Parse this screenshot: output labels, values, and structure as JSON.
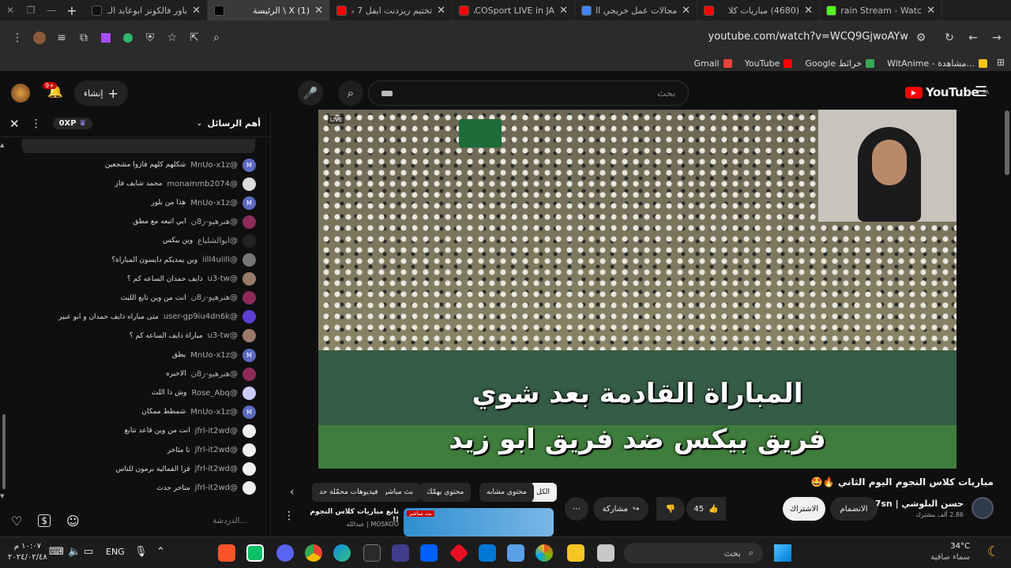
{
  "tabs": [
    {
      "title": "باور فالكونز ابوعابد الـ",
      "favicon": "tiktok-icon",
      "color": "#111111",
      "active": false
    },
    {
      "title": "(1) X \\ الرئيسة",
      "favicon": "x-icon",
      "color": "#000000",
      "active": true
    },
    {
      "title": "تختيم ريزدنت ايفل 7 ب",
      "favicon": "youtube-icon",
      "color": "#ff0000",
      "active": false
    },
    {
      "title": "JACOSport LIVE in JA",
      "favicon": "youtube-icon",
      "color": "#ff0000",
      "active": false
    },
    {
      "title": "مجالات عمل خريجي ال",
      "favicon": "gemini-icon",
      "color": "#4285f4",
      "active": false
    },
    {
      "title": "(4680) مباريات كلا",
      "favicon": "youtube-icon",
      "color": "#ff0000",
      "active": false
    },
    {
      "title": "Brain Stream - Watc",
      "favicon": "kick-icon",
      "color": "#53fc18",
      "active": false
    }
  ],
  "address": {
    "url": "youtube.com/watch?v=WCQ9GjwoAYw"
  },
  "bookmarks": [
    {
      "label": "Gmail",
      "color": "#ea4335"
    },
    {
      "label": "YouTube",
      "color": "#ff0000"
    },
    {
      "label": "Google خرائط",
      "color": "#34a853"
    },
    {
      "label": "WitAnime - مشاهدة...",
      "color": "#f5c518"
    }
  ],
  "youtube": {
    "logo": "YouTube",
    "region": "SA",
    "search_placeholder": "بحث",
    "create_label": "إنشاء",
    "notif_count": "9+"
  },
  "chat": {
    "title": "أهم الرسائل",
    "points": "0XP",
    "input_placeholder": "الدردشة...",
    "messages": [
      {
        "user": "@MnUo-x1z",
        "text": "شكلهم كلهم فازوا مشجعين",
        "avatar": "M",
        "color": "#5c6bc0"
      },
      {
        "user": "@monammb2074",
        "text": "محمد شايف فاز",
        "avatar": "",
        "color": "#dddddd"
      },
      {
        "user": "@MnUo-x1z",
        "text": "هذا من بلور",
        "avatar": "M",
        "color": "#5c6bc0"
      },
      {
        "user": "@هنرهيو-ز8ن",
        "text": "ابي اتبعه مع مطق",
        "avatar": "",
        "color": "#8e2a5a"
      },
      {
        "user": "@ابوالشلباع",
        "text": "وين بيكس",
        "avatar": "",
        "color": "#222222"
      },
      {
        "user": "@iill4uiill",
        "text": "وين يمديكم دايسون المباراة؟",
        "avatar": "",
        "color": "#777777"
      },
      {
        "user": "@u3-tw",
        "text": "ذايف حمدان الساعه كم ؟",
        "avatar": "",
        "color": "#9a7a6a"
      },
      {
        "user": "@هنرهيو-ز8ن",
        "text": "انت من وين تابع الليث",
        "avatar": "",
        "color": "#8e2a5a"
      },
      {
        "user": "@user-gp9iu4dn6k",
        "text": "متى مباراه ذايف حمدان و ابو عبير",
        "avatar": "",
        "color": "#5d3fd3"
      },
      {
        "user": "@u3-tw",
        "text": "مباراة ذايف الساعه كم ؟",
        "avatar": "",
        "color": "#9a7a6a"
      },
      {
        "user": "@MnUo-x1z",
        "text": "يطق",
        "avatar": "M",
        "color": "#5c6bc0"
      },
      {
        "user": "@هنرهيو-ز8ن",
        "text": "الاخيره",
        "avatar": "",
        "color": "#8e2a5a"
      },
      {
        "user": "@Rose_Abq",
        "text": "وش ذا اللت",
        "avatar": "",
        "color": "#ccccff"
      },
      {
        "user": "@MnUo-x1z",
        "text": "شمطط ممكان",
        "avatar": "M",
        "color": "#5c6bc0"
      },
      {
        "user": "@jfrl-it2wd",
        "text": "انت من وين قاعد تتابع",
        "avatar": "",
        "color": "#f0f0f0"
      },
      {
        "user": "@jfrl-it2wd",
        "text": "تا مثاخر",
        "avatar": "",
        "color": "#f0f0f0"
      },
      {
        "user": "@jfrl-it2wd",
        "text": "قرا القمالية برمون للناس",
        "avatar": "",
        "color": "#f0f0f0"
      },
      {
        "user": "@jfrl-it2wd",
        "text": "متاخر حدث",
        "avatar": "",
        "color": "#f0f0f0"
      }
    ]
  },
  "video": {
    "subtitle_line1": "المباراة القادمة بعد شوي",
    "subtitle_line2": "فريق بيكس ضد فريق ابو زيد",
    "live_badge": "LIVE"
  },
  "meta": {
    "title": "مباريات كلاس النجوم اليوم الثاني 🔥🤩",
    "channel": "حسن البلوشي | Op7sn",
    "subscribers": "2.86 ألف مشترك",
    "join_label": "الانضمام",
    "subscribe_label": "الاشتراك",
    "likes": "45",
    "share_label": "مشاركة",
    "chips": [
      "الكل",
      "محتوى مشابه",
      "محتوى يهمّك",
      "بث مباشر",
      "فيديوهات محمّلة حد"
    ],
    "rec_title": "تابع مباريات كلاس النجوم !!",
    "rec_channel": "MOSKOO | عبدالله",
    "rec_badge": "بث مباشر"
  },
  "taskbar": {
    "time": "١٠:٠٧ م",
    "date": "٢٠٢٤/٠٢/٤٨",
    "language": "ENG",
    "weather_temp": "34°C",
    "weather_desc": "سماء صافية",
    "search_placeholder": "بحث"
  }
}
